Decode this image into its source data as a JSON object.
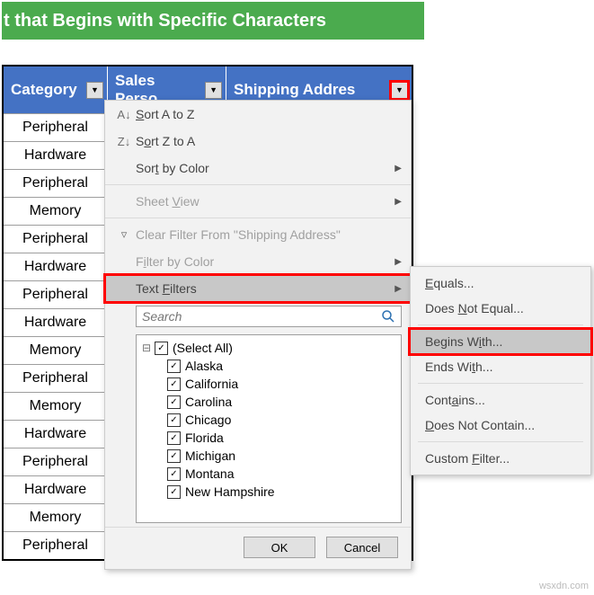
{
  "banner": "t that Begins with Specific Characters",
  "headers": {
    "category": "Category",
    "sales": "Sales Perso",
    "shipping": "Shipping Addres"
  },
  "rows": [
    "Peripheral",
    "Hardware",
    "Peripheral",
    "Memory",
    "Peripheral",
    "Hardware",
    "Peripheral",
    "Hardware",
    "Memory",
    "Peripheral",
    "Memory",
    "Hardware",
    "Peripheral",
    "Hardware",
    "Memory",
    "Peripheral"
  ],
  "menu": {
    "sortAZ": "Sort A to Z",
    "sortZA": "Sort Z to A",
    "sortByColor": "Sort by Color",
    "sheetView": "Sheet View",
    "clearFilter": "Clear Filter From \"Shipping Address\"",
    "filterByColor": "Filter by Color",
    "textFilters": "Text Filters",
    "searchPlaceholder": "Search",
    "selectAll": "(Select All)",
    "items": [
      "Alaska",
      "California",
      "Carolina",
      "Chicago",
      "Florida",
      "Michigan",
      "Montana",
      "New Hampshire"
    ],
    "ok": "OK",
    "cancel": "Cancel"
  },
  "submenu": {
    "equals": "Equals...",
    "doesNotEqual": "Does Not Equal...",
    "beginsWith": "Begins With...",
    "endsWith": "Ends With...",
    "contains": "Contains...",
    "doesNotContain": "Does Not Contain...",
    "customFilter": "Custom Filter..."
  },
  "watermark": "wsxdn.com"
}
